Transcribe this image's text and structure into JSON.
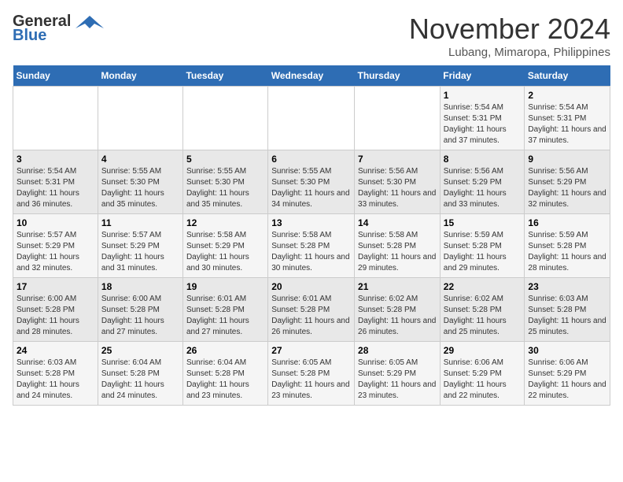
{
  "header": {
    "logo_line1": "General",
    "logo_line2": "Blue",
    "month_title": "November 2024",
    "location": "Lubang, Mimaropa, Philippines"
  },
  "days_of_week": [
    "Sunday",
    "Monday",
    "Tuesday",
    "Wednesday",
    "Thursday",
    "Friday",
    "Saturday"
  ],
  "weeks": [
    [
      {
        "day": "",
        "info": ""
      },
      {
        "day": "",
        "info": ""
      },
      {
        "day": "",
        "info": ""
      },
      {
        "day": "",
        "info": ""
      },
      {
        "day": "",
        "info": ""
      },
      {
        "day": "1",
        "info": "Sunrise: 5:54 AM\nSunset: 5:31 PM\nDaylight: 11 hours and 37 minutes."
      },
      {
        "day": "2",
        "info": "Sunrise: 5:54 AM\nSunset: 5:31 PM\nDaylight: 11 hours and 37 minutes."
      }
    ],
    [
      {
        "day": "3",
        "info": "Sunrise: 5:54 AM\nSunset: 5:31 PM\nDaylight: 11 hours and 36 minutes."
      },
      {
        "day": "4",
        "info": "Sunrise: 5:55 AM\nSunset: 5:30 PM\nDaylight: 11 hours and 35 minutes."
      },
      {
        "day": "5",
        "info": "Sunrise: 5:55 AM\nSunset: 5:30 PM\nDaylight: 11 hours and 35 minutes."
      },
      {
        "day": "6",
        "info": "Sunrise: 5:55 AM\nSunset: 5:30 PM\nDaylight: 11 hours and 34 minutes."
      },
      {
        "day": "7",
        "info": "Sunrise: 5:56 AM\nSunset: 5:30 PM\nDaylight: 11 hours and 33 minutes."
      },
      {
        "day": "8",
        "info": "Sunrise: 5:56 AM\nSunset: 5:29 PM\nDaylight: 11 hours and 33 minutes."
      },
      {
        "day": "9",
        "info": "Sunrise: 5:56 AM\nSunset: 5:29 PM\nDaylight: 11 hours and 32 minutes."
      }
    ],
    [
      {
        "day": "10",
        "info": "Sunrise: 5:57 AM\nSunset: 5:29 PM\nDaylight: 11 hours and 32 minutes."
      },
      {
        "day": "11",
        "info": "Sunrise: 5:57 AM\nSunset: 5:29 PM\nDaylight: 11 hours and 31 minutes."
      },
      {
        "day": "12",
        "info": "Sunrise: 5:58 AM\nSunset: 5:29 PM\nDaylight: 11 hours and 30 minutes."
      },
      {
        "day": "13",
        "info": "Sunrise: 5:58 AM\nSunset: 5:28 PM\nDaylight: 11 hours and 30 minutes."
      },
      {
        "day": "14",
        "info": "Sunrise: 5:58 AM\nSunset: 5:28 PM\nDaylight: 11 hours and 29 minutes."
      },
      {
        "day": "15",
        "info": "Sunrise: 5:59 AM\nSunset: 5:28 PM\nDaylight: 11 hours and 29 minutes."
      },
      {
        "day": "16",
        "info": "Sunrise: 5:59 AM\nSunset: 5:28 PM\nDaylight: 11 hours and 28 minutes."
      }
    ],
    [
      {
        "day": "17",
        "info": "Sunrise: 6:00 AM\nSunset: 5:28 PM\nDaylight: 11 hours and 28 minutes."
      },
      {
        "day": "18",
        "info": "Sunrise: 6:00 AM\nSunset: 5:28 PM\nDaylight: 11 hours and 27 minutes."
      },
      {
        "day": "19",
        "info": "Sunrise: 6:01 AM\nSunset: 5:28 PM\nDaylight: 11 hours and 27 minutes."
      },
      {
        "day": "20",
        "info": "Sunrise: 6:01 AM\nSunset: 5:28 PM\nDaylight: 11 hours and 26 minutes."
      },
      {
        "day": "21",
        "info": "Sunrise: 6:02 AM\nSunset: 5:28 PM\nDaylight: 11 hours and 26 minutes."
      },
      {
        "day": "22",
        "info": "Sunrise: 6:02 AM\nSunset: 5:28 PM\nDaylight: 11 hours and 25 minutes."
      },
      {
        "day": "23",
        "info": "Sunrise: 6:03 AM\nSunset: 5:28 PM\nDaylight: 11 hours and 25 minutes."
      }
    ],
    [
      {
        "day": "24",
        "info": "Sunrise: 6:03 AM\nSunset: 5:28 PM\nDaylight: 11 hours and 24 minutes."
      },
      {
        "day": "25",
        "info": "Sunrise: 6:04 AM\nSunset: 5:28 PM\nDaylight: 11 hours and 24 minutes."
      },
      {
        "day": "26",
        "info": "Sunrise: 6:04 AM\nSunset: 5:28 PM\nDaylight: 11 hours and 23 minutes."
      },
      {
        "day": "27",
        "info": "Sunrise: 6:05 AM\nSunset: 5:28 PM\nDaylight: 11 hours and 23 minutes."
      },
      {
        "day": "28",
        "info": "Sunrise: 6:05 AM\nSunset: 5:29 PM\nDaylight: 11 hours and 23 minutes."
      },
      {
        "day": "29",
        "info": "Sunrise: 6:06 AM\nSunset: 5:29 PM\nDaylight: 11 hours and 22 minutes."
      },
      {
        "day": "30",
        "info": "Sunrise: 6:06 AM\nSunset: 5:29 PM\nDaylight: 11 hours and 22 minutes."
      }
    ]
  ]
}
